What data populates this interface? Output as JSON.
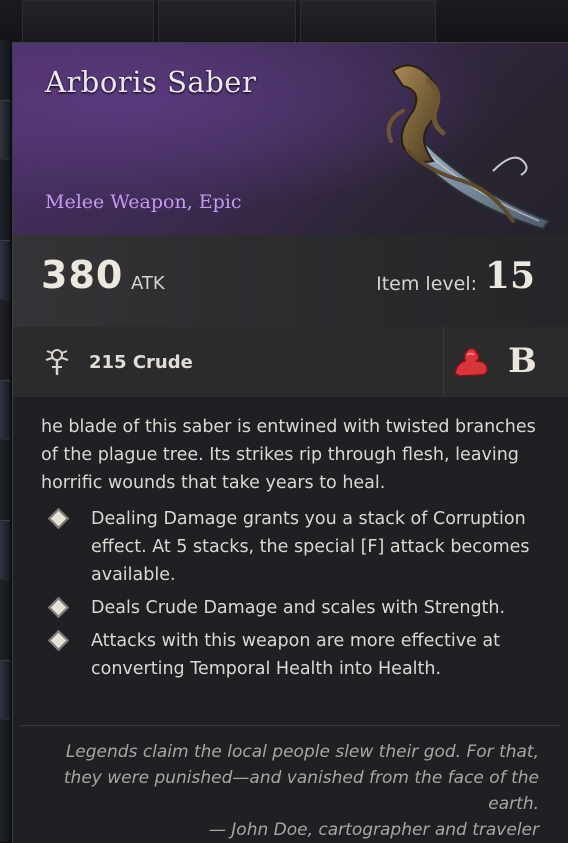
{
  "item": {
    "name": "Arboris Saber",
    "type": "Melee Weapon, Epic",
    "rarity_color": "#c49af0"
  },
  "stats": {
    "attack_value": "380",
    "attack_label": "ATK",
    "item_level_label": "Item level:",
    "item_level_value": "15"
  },
  "requirements": {
    "damage_type_icon": "crude-damage-icon",
    "damage_text": "215 Crude",
    "scaling_icon": "strength-arm-icon",
    "scaling_grade": "B"
  },
  "description": {
    "lore": "he blade of this saber is entwined with twisted branches of the plague tree. Its strikes rip through flesh, leaving horrific wounds that take years to heal.",
    "bullets": [
      "Dealing Damage grants you a stack of Corruption effect. At 5 stacks, the special [F] attack becomes available.",
      "Deals Crude Damage and scales with Strength.",
      "Attacks with this weapon are more effective at converting Temporal Health into Health."
    ],
    "quote": "Legends claim the local people slew their god. For that, they were punished—and vanished from the face of the earth.",
    "quote_author": "— John Doe, cartographer and traveler"
  }
}
